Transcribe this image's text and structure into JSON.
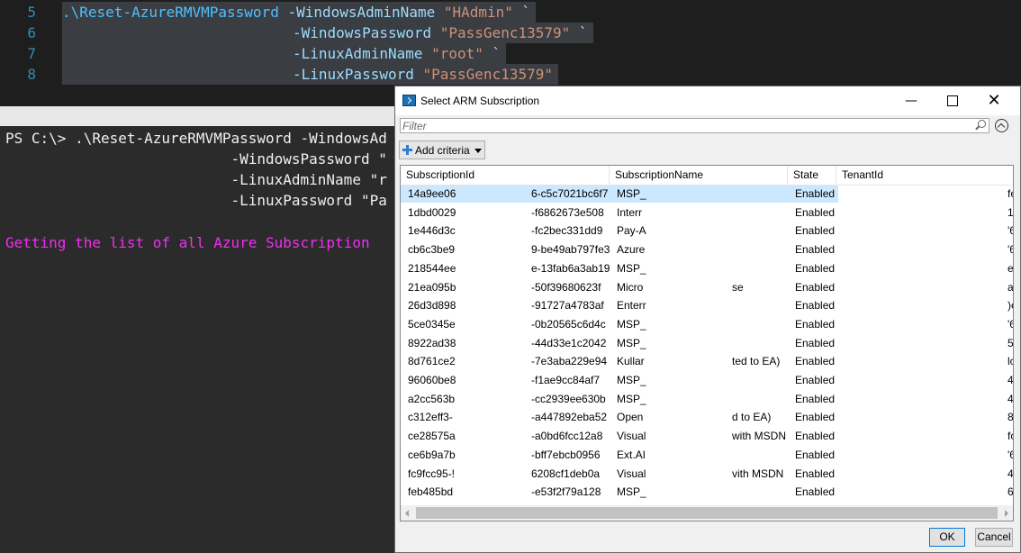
{
  "editor": {
    "lines": [
      {
        "num": "5",
        "cmd": ".\\Reset-AzureRMVMPassword ",
        "param": "-WindowsAdminName ",
        "value": "\"HAdmin\"",
        "tail": " `"
      },
      {
        "num": "6",
        "cmd": "",
        "param": "-WindowsPassword ",
        "value": "\"PassGenc13579\"",
        "tail": " `"
      },
      {
        "num": "7",
        "cmd": "",
        "param": "-LinuxAdminName ",
        "value": "\"root\"",
        "tail": " `"
      },
      {
        "num": "8",
        "cmd": "",
        "param": "-LinuxPassword ",
        "value": "\"PassGenc13579\"",
        "tail": ""
      }
    ]
  },
  "console": {
    "lines": [
      "PS C:\\> .\\Reset-AzureRMVMPassword -WindowsAd",
      "                          -WindowsPassword \"",
      "                          -LinuxAdminName \"r",
      "                          -LinuxPassword \"Pa"
    ],
    "status": "Getting the list of all Azure Subscription"
  },
  "dialog": {
    "title": "Select ARM Subscription",
    "filter_placeholder": "Filter",
    "add_criteria_label": "Add criteria",
    "columns": [
      "SubscriptionId",
      "SubscriptionName",
      "State",
      "TenantId"
    ],
    "rows": [
      {
        "id_a": "14a9ee06",
        "id_b": "6-c5c7021bc6f7",
        "name_a": "MSP_",
        "name_b": "",
        "state": "Enabled",
        "tenant": "fe",
        "selected": true
      },
      {
        "id_a": "1dbd0029",
        "id_b": "-f6862673e508",
        "name_a": "Interr",
        "name_b": "",
        "state": "Enabled",
        "tenant": "1",
        "selected": false
      },
      {
        "id_a": "1e446d3c",
        "id_b": "-fc2bec331dd9",
        "name_a": "Pay-A",
        "name_b": "",
        "state": "Enabled",
        "tenant": "'6",
        "selected": false
      },
      {
        "id_a": "cb6c3be9",
        "id_b": "9-be49ab797fe3",
        "name_a": "Azure",
        "name_b": "",
        "state": "Enabled",
        "tenant": "'6",
        "selected": false
      },
      {
        "id_a": "218544ee",
        "id_b": "e-13fab6a3ab19",
        "name_a": "MSP_",
        "name_b": "",
        "state": "Enabled",
        "tenant": "e",
        "selected": false
      },
      {
        "id_a": "21ea095b",
        "id_b": "-50f39680623f",
        "name_a": "Micro",
        "name_b": "se",
        "state": "Enabled",
        "tenant": "a",
        "selected": false
      },
      {
        "id_a": "26d3d898",
        "id_b": "-91727a4783af",
        "name_a": "Enterr",
        "name_b": "",
        "state": "Enabled",
        "tenant": ")e",
        "selected": false
      },
      {
        "id_a": "5ce0345e",
        "id_b": "-0b20565c6d4c",
        "name_a": "MSP_",
        "name_b": "",
        "state": "Enabled",
        "tenant": "'6",
        "selected": false
      },
      {
        "id_a": "8922ad38",
        "id_b": "-44d33e1c2042",
        "name_a": "MSP_",
        "name_b": "",
        "state": "Enabled",
        "tenant": "5a",
        "selected": false
      },
      {
        "id_a": "8d761ce2",
        "id_b": "-7e3aba229e94",
        "name_a": "Kullar",
        "name_b": "ted to EA)",
        "state": "Enabled",
        "tenant": "lc",
        "selected": false
      },
      {
        "id_a": "96060be8",
        "id_b": "-f1ae9cc84af7",
        "name_a": "MSP_",
        "name_b": "",
        "state": "Enabled",
        "tenant": "4",
        "selected": false
      },
      {
        "id_a": "a2cc563b",
        "id_b": "-cc2939ee630b",
        "name_a": "MSP_",
        "name_b": "",
        "state": "Enabled",
        "tenant": "4",
        "selected": false
      },
      {
        "id_a": "c312eff3-",
        "id_b": "-a447892eba52",
        "name_a": "Open",
        "name_b": "d to EA)",
        "state": "Enabled",
        "tenant": "8",
        "selected": false
      },
      {
        "id_a": "ce28575a",
        "id_b": "-a0bd6fcc12a8",
        "name_a": "Visual",
        "name_b": "with MSDN",
        "state": "Enabled",
        "tenant": "fc",
        "selected": false
      },
      {
        "id_a": "ce6b9a7b",
        "id_b": "-bff7ebcb0956",
        "name_a": "Ext.AI",
        "name_b": "",
        "state": "Enabled",
        "tenant": "'6",
        "selected": false
      },
      {
        "id_a": "fc9fcc95-!",
        "id_b": "6208cf1deb0a",
        "name_a": "Visual",
        "name_b": "vith MSDN",
        "state": "Enabled",
        "tenant": "4e",
        "selected": false
      },
      {
        "id_a": "feb485bd",
        "id_b": "-e53f2f79a128",
        "name_a": "MSP_",
        "name_b": "",
        "state": "Enabled",
        "tenant": "6",
        "selected": false
      }
    ],
    "ok_label": "OK",
    "cancel_label": "Cancel"
  },
  "colors": {
    "console_magenta": "#f02ef0",
    "selection": "#cce8ff",
    "line_number": "#2b91af"
  }
}
